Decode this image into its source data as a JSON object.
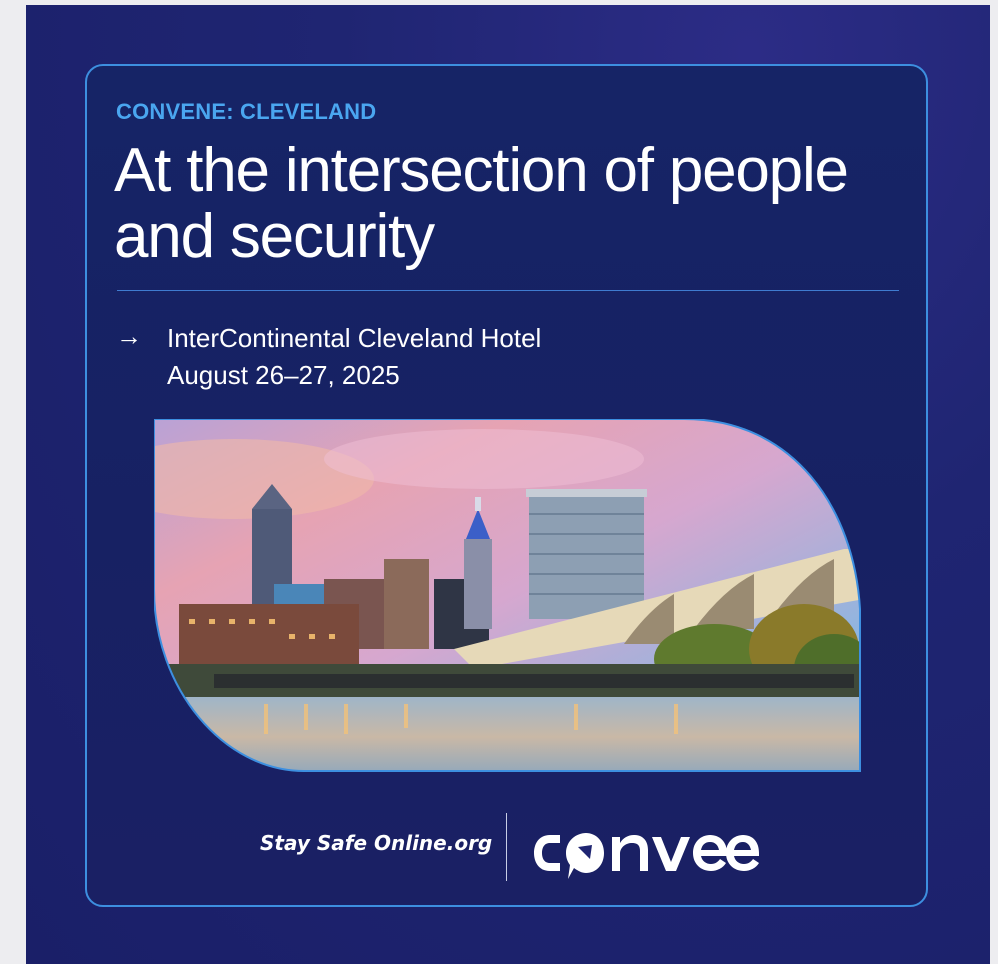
{
  "event": {
    "eyebrow": "CONVENE: CLEVELAND",
    "headline": "At the intersection of people and security",
    "arrow_icon": "arrow-right-icon",
    "venue": "InterContinental Cleveland Hotel",
    "date": "August 26–27, 2025"
  },
  "footer": {
    "partner": "Stay Safe Online.org",
    "brand_logo_text": "convene"
  },
  "colors": {
    "background": "#1f2572",
    "frame_border": "#3d8fe0",
    "eyebrow": "#4aa6f0",
    "text": "#ffffff"
  }
}
